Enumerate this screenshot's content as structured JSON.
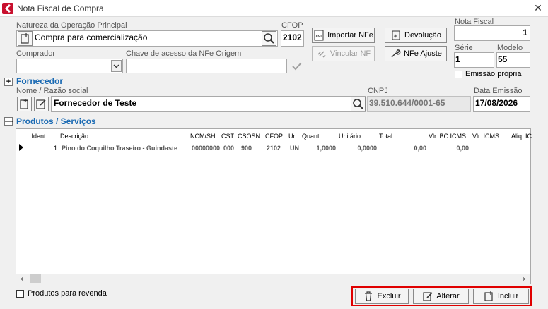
{
  "window": {
    "title": "Nota Fiscal de Compra",
    "close": "✕"
  },
  "natureza": {
    "label": "Natureza da Operação Principal",
    "value": "Compra para comercialização"
  },
  "cfop": {
    "label": "CFOP",
    "value": "2102"
  },
  "buttons": {
    "importar": "Importar NFe",
    "vincular": "Vincular NF",
    "devolucao": "Devolução",
    "ajuste": "NFe Ajuste",
    "excluir": "Excluir",
    "alterar": "Alterar",
    "incluir": "Incluir"
  },
  "nota": {
    "label": "Nota Fiscal",
    "value": "1"
  },
  "serie": {
    "label": "Série",
    "value": "1"
  },
  "modelo": {
    "label": "Modelo",
    "value": "55"
  },
  "emissao_propria": {
    "label": "Emissão própria"
  },
  "comprador": {
    "label": "Comprador",
    "value": ""
  },
  "chave": {
    "label": "Chave de acesso da NFe Origem",
    "value": ""
  },
  "fornecedor": {
    "section": "Fornecedor",
    "toggle": "+",
    "nome_label": "Nome / Razão social",
    "nome": "Fornecedor de Teste",
    "cnpj_label": "CNPJ",
    "cnpj": "39.510.644/0001-65",
    "data_label": "Data Emissão",
    "data": "17/08/2026"
  },
  "produtos": {
    "section": "Produtos / Serviços",
    "toggle": "—",
    "columns": [
      "Ident.",
      "Descrição",
      "NCM/SH",
      "CST",
      "CSOSN",
      "CFOP",
      "Un.",
      "Quant.",
      "Unitário",
      "Total",
      "Vlr. BC ICMS",
      "Vlr. ICMS",
      "Aliq. IC"
    ],
    "row": [
      "1",
      "Pino do Coquilho Traseiro - Guindaste",
      "00000000",
      "000",
      "900",
      "2102",
      "UN",
      "1,0000",
      "0,0000",
      "0,00",
      "0,00",
      "",
      ""
    ]
  },
  "revenda": {
    "label": "Produtos para revenda"
  }
}
